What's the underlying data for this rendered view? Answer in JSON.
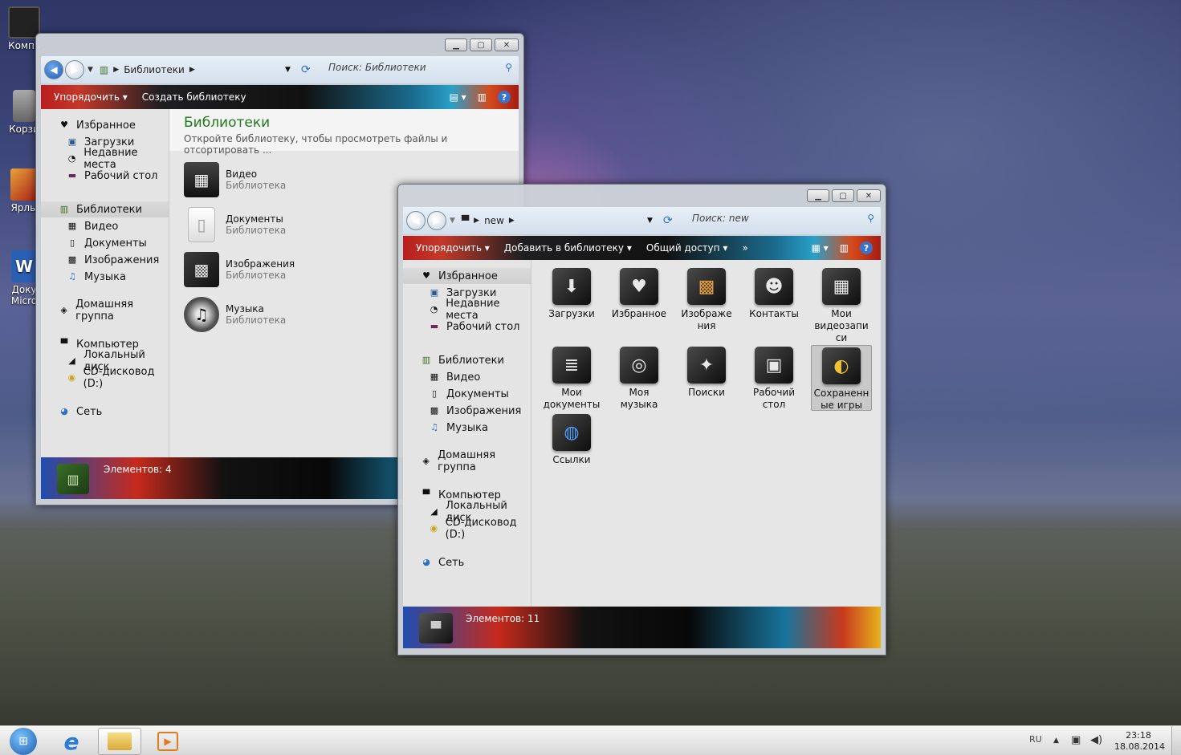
{
  "desktop": {
    "icons": [
      {
        "label": "Компь",
        "color": "#2a2a2a"
      },
      {
        "label": "Корзи",
        "color": "#8d8f92"
      },
      {
        "label": "Ярлы",
        "color": "#c85b1c"
      },
      {
        "label": "Доку Micro",
        "color": "#2b5fb3"
      }
    ]
  },
  "window1": {
    "breadcrumb": [
      "Библиотеки"
    ],
    "search_placeholder": "Поиск: Библиотеки",
    "commands": [
      "Упорядочить",
      "Создать библиотеку"
    ],
    "heading": "Библиотеки",
    "subheading": "Откройте библиотеку, чтобы просмотреть файлы и отсортировать ...",
    "nav": [
      {
        "label": "Избранное",
        "icon": "heart-icon",
        "glyph": "♥"
      },
      {
        "label": "Загрузки",
        "icon": "downloads-icon",
        "glyph": "▣"
      },
      {
        "label": "Недавние места",
        "icon": "recent-icon",
        "glyph": "◔"
      },
      {
        "label": "Рабочий стол",
        "icon": "desktop-icon",
        "glyph": "▬"
      },
      {
        "label": "Библиотеки",
        "icon": "libraries-icon",
        "glyph": "▥"
      },
      {
        "label": "Видео",
        "icon": "video-icon",
        "glyph": "▦"
      },
      {
        "label": "Документы",
        "icon": "documents-icon",
        "glyph": "▯"
      },
      {
        "label": "Изображения",
        "icon": "images-icon",
        "glyph": "▩"
      },
      {
        "label": "Музыка",
        "icon": "music-icon",
        "glyph": "♫"
      },
      {
        "label": "Домашняя группа",
        "icon": "homegroup-icon",
        "glyph": "◈"
      },
      {
        "label": "Компьютер",
        "icon": "computer-icon",
        "glyph": "▀"
      },
      {
        "label": "Локальный диск",
        "icon": "disk-icon",
        "glyph": "◢"
      },
      {
        "label": "CD-дисковод (D:)",
        "icon": "cd-icon",
        "glyph": "◉"
      },
      {
        "label": "Сеть",
        "icon": "network-icon",
        "glyph": "◕"
      }
    ],
    "items": [
      {
        "name": "Видео",
        "sub": "Библиотека",
        "icon": "video-library-icon"
      },
      {
        "name": "Документы",
        "sub": "Библиотека",
        "icon": "documents-library-icon"
      },
      {
        "name": "Изображения",
        "sub": "Библиотека",
        "icon": "images-library-icon"
      },
      {
        "name": "Музыка",
        "sub": "Библиотека",
        "icon": "music-library-icon"
      }
    ],
    "status": "Элементов: 4"
  },
  "window2": {
    "breadcrumb": [
      "new"
    ],
    "search_placeholder": "Поиск: new",
    "commands": [
      "Упорядочить",
      "Добавить в библиотеку",
      "Общий доступ",
      "»"
    ],
    "nav": [
      {
        "label": "Избранное",
        "icon": "heart-icon",
        "glyph": "♥"
      },
      {
        "label": "Загрузки",
        "icon": "downloads-icon",
        "glyph": "▣"
      },
      {
        "label": "Недавние места",
        "icon": "recent-icon",
        "glyph": "◔"
      },
      {
        "label": "Рабочий стол",
        "icon": "desktop-icon",
        "glyph": "▬"
      },
      {
        "label": "Библиотеки",
        "icon": "libraries-icon",
        "glyph": "▥"
      },
      {
        "label": "Видео",
        "icon": "video-icon",
        "glyph": "▦"
      },
      {
        "label": "Документы",
        "icon": "documents-icon",
        "glyph": "▯"
      },
      {
        "label": "Изображения",
        "icon": "images-icon",
        "glyph": "▩"
      },
      {
        "label": "Музыка",
        "icon": "music-icon",
        "glyph": "♫"
      },
      {
        "label": "Домашняя группа",
        "icon": "homegroup-icon",
        "glyph": "◈"
      },
      {
        "label": "Компьютер",
        "icon": "computer-icon",
        "glyph": "▀"
      },
      {
        "label": "Локальный диск",
        "icon": "disk-icon",
        "glyph": "◢"
      },
      {
        "label": "CD-дисковод (D:)",
        "icon": "cd-icon",
        "glyph": "◉"
      },
      {
        "label": "Сеть",
        "icon": "network-icon",
        "glyph": "◕"
      }
    ],
    "items": [
      {
        "l1": "Загрузки",
        "l2": "",
        "l3": "",
        "icon": "downloads-folder-icon",
        "glyph": "⬇"
      },
      {
        "l1": "Избранное",
        "l2": "",
        "l3": "",
        "icon": "favorites-folder-icon",
        "glyph": "♥"
      },
      {
        "l1": "Изображе",
        "l2": "ния",
        "l3": "",
        "icon": "pictures-folder-icon",
        "glyph": "▩"
      },
      {
        "l1": "Контакты",
        "l2": "",
        "l3": "",
        "icon": "contacts-folder-icon",
        "glyph": "☻"
      },
      {
        "l1": "Мои",
        "l2": "видеозапи",
        "l3": "си",
        "icon": "videos-folder-icon",
        "glyph": "▦"
      },
      {
        "l1": "Мои",
        "l2": "документы",
        "l3": "",
        "icon": "documents-folder-icon",
        "glyph": "≣"
      },
      {
        "l1": "Моя",
        "l2": "музыка",
        "l3": "",
        "icon": "music-folder-icon",
        "glyph": "◎"
      },
      {
        "l1": "Поиски",
        "l2": "",
        "l3": "",
        "icon": "searches-folder-icon",
        "glyph": "✦"
      },
      {
        "l1": "Рабочий",
        "l2": "стол",
        "l3": "",
        "icon": "desktop-folder-icon",
        "glyph": "▣"
      },
      {
        "l1": "Сохраненн",
        "l2": "ые игры",
        "l3": "",
        "icon": "saved-games-folder-icon",
        "glyph": "◐"
      },
      {
        "l1": "Ссылки",
        "l2": "",
        "l3": "",
        "icon": "links-folder-icon",
        "glyph": "◍"
      }
    ],
    "status": "Элементов: 11"
  },
  "taskbar": {
    "lang": "RU",
    "time": "23:18",
    "date": "18.08.2014"
  }
}
